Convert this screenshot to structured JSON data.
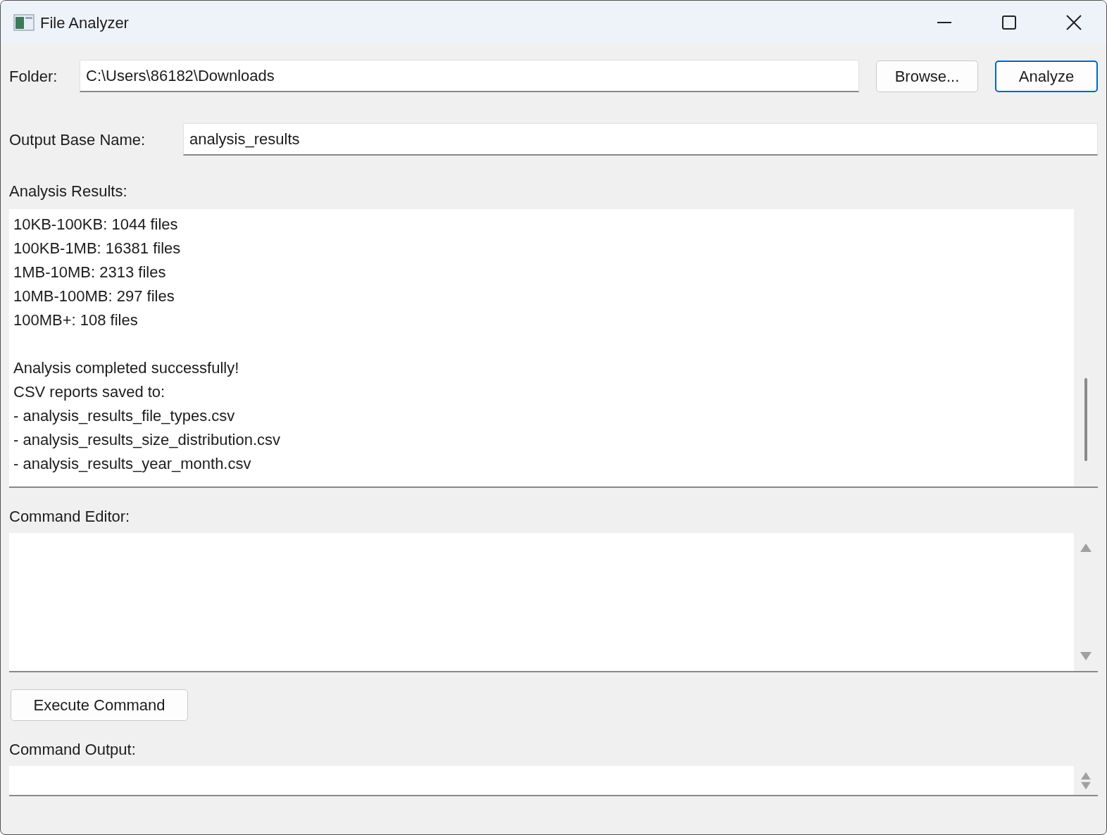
{
  "window": {
    "title": "File Analyzer"
  },
  "folder": {
    "label": "Folder:",
    "value": "C:\\Users\\86182\\Downloads"
  },
  "buttons": [
    {
      "label": "Browse...",
      "focused": false
    },
    {
      "label": "Analyze",
      "focused": true
    }
  ],
  "output_base_name": {
    "label": "Output Base Name:",
    "value": "analysis_results"
  },
  "analysis_results": {
    "label": "Analysis Results:",
    "paragraphs": [
      [
        "10KB-100KB: 1044 files",
        "100KB-1MB: 16381 files",
        "1MB-10MB: 2313 files",
        "10MB-100MB: 297 files",
        "100MB+: 108 files"
      ],
      [
        "Analysis completed successfully!",
        "CSV reports saved to:",
        "- analysis_results_file_types.csv",
        "- analysis_results_size_distribution.csv",
        "- analysis_results_year_month.csv"
      ]
    ]
  },
  "command_editor": {
    "label": "Command Editor:"
  },
  "execute_button": {
    "label": "Execute Command"
  },
  "command_output": {
    "label": "Command Output:"
  }
}
